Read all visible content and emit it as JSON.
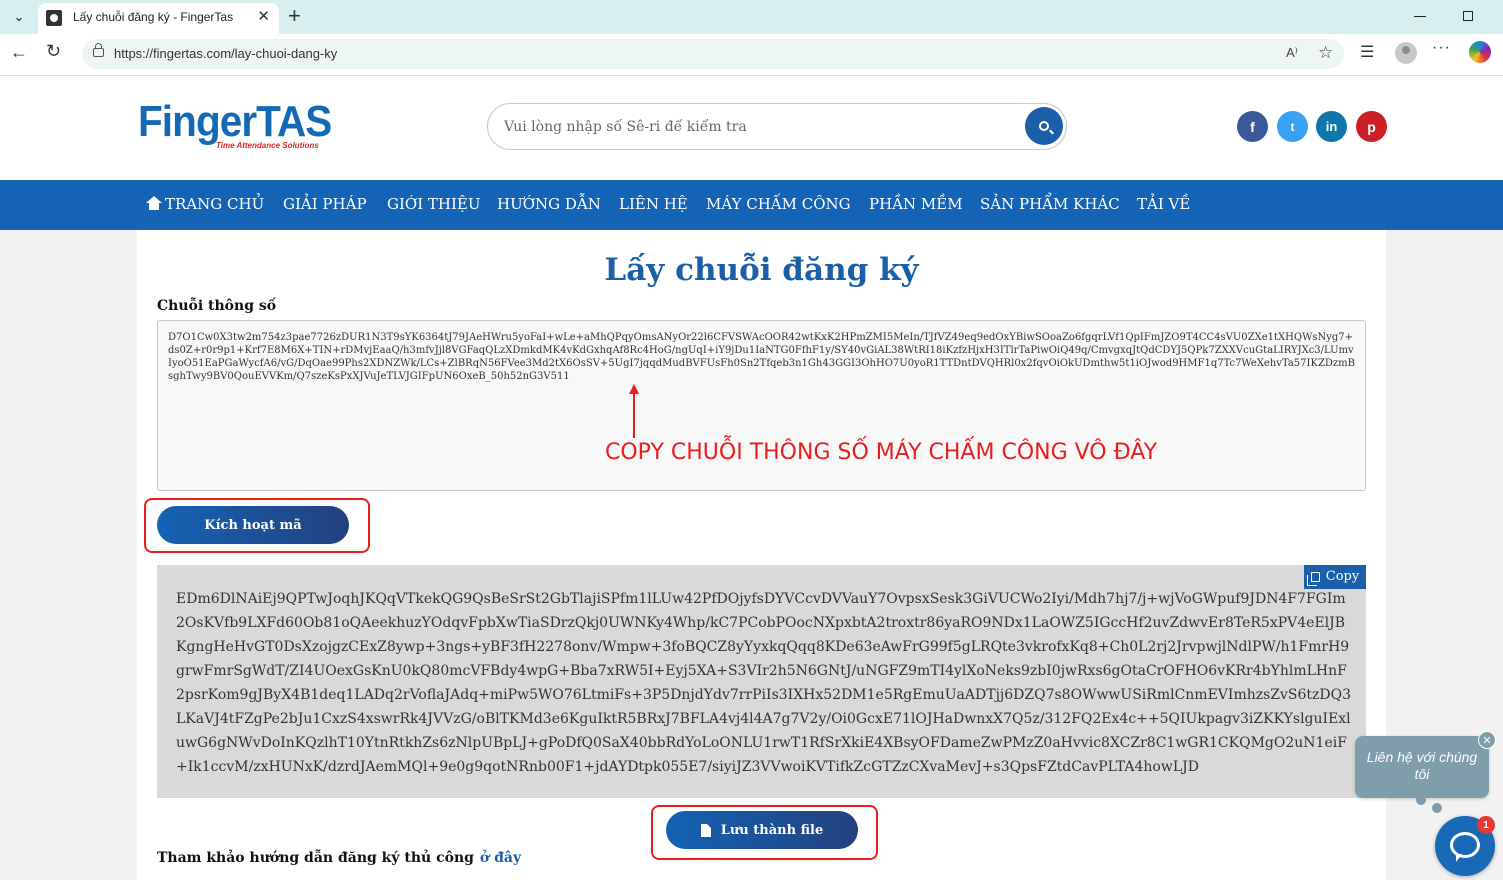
{
  "browser": {
    "tab_title": "Lấy chuỗi đăng ký - FingerTas",
    "url": "https://fingertas.com/lay-chuoi-dang-ky"
  },
  "header": {
    "logo_text": "FingerTAS",
    "logo_tagline": "Time Attendance Solutions",
    "search_placeholder": "Vui lòng nhập số Sê-ri để kiểm tra",
    "social": [
      "f",
      "t",
      "in",
      "p"
    ]
  },
  "nav": {
    "items": [
      "TRANG CHỦ",
      "GIẢI PHÁP",
      "GIỚI THIỆU",
      "HƯỚNG DẪN",
      "LIÊN HỆ",
      "MÁY CHẤM CÔNG",
      "PHẦN MỀM",
      "SẢN PHẨM KHÁC",
      "TẢI VỀ"
    ]
  },
  "main": {
    "title": "Lấy chuỗi đăng ký",
    "field_label": "Chuỗi thông số",
    "param_value": "D7O1Cw0X3tw2m754z3pae7726zDUR1N3T9sYK6364tJ79JAeHWru5yoFaI+wLe+aMhQPqyOmsANyOr22l6CFVSWAcOOR42wtKxK2HPmZMI5MeIn/TJfVZ49eq9edOxYBiwSOoaZo6fgqrLVf1QpIFmJZO9T4CC4sVU0ZXe1tXHQWsNyg7+ds0Z+r0r9p1+Krf7E8M6X+TIN+rDMvjEaaQ/h3mfvJjl8VGFaqQLzXDmkdMK4vKdGxhqAf8Rc4HoG/ngUqI+iY9jDu1IaNTG0FfhF1y/SY40vGiAL38WtRI18iKzfzHjxH3ITlrTaPiwOiQ49q/CmvgxqJtQdCDYJ5QPk7ZXXVcuGtaLIRYJXc3/LUmvIyoO51EaPGaWycfA6/vG/DqOae99Phs2XDNZWk/LCs+ZlBRqN56FVee3Md2tX6OsSV+5UgI7jqqdMudBVFUsFh0Sn2Tfqeb3n1Gh43GGI3OhHO7U0yoR1TTDntDVQHRl0x2fqvOiOkUDmthw5t1iOJwod9HMF1q7Tc7WeXehvTa57IKZDzmBsghTwy9BV0QouEVVKm/Q7szeKsPxXJVuJeTLVJGIFpUN6OxeB_50h52nG3V511",
    "annotation": "COPY CHUỖI THÔNG SỐ MÁY CHẤM CÔNG VÔ ĐÂY",
    "activate_label": "Kích hoạt mã",
    "copy_label": "Copy",
    "result_value": "EDm6DlNAiEj9QPTwJoqhJKQqVTkekQG9QsBeSrSt2GbTlajiSPfm1lLUw42PfDOjyfsDYVCcvDVVauY7OvpsxSesk3GiVUCWo2Iyi/Mdh7hj7/j+wjVoGWpuf9JDN4F7FGIm2OsKVfb9LXFd60Ob81oQAeekhuzYOdqvFpbXwTiaSDrzQkj0UWNKy4Whp/kC7PCobPOocNXpxbtA2troxtr86yaRO9NDx1LaOWZ5IGccHf2uvZdwvEr8TeR5xPV4eElJBKgngHeHvGT0DsXzojgzCExZ8ywp+3ngs+yBF3fH2278onv/Wmpw+3foBQCZ8yYyxkqQqq8KDe63eAwFrG99f5gLRQte3vkrofxKq8+Ch0L2rj2JrvpwjlNdlPW/h1FmrH9grwFmrSgWdT/ZI4UOexGsKnU0kQ80mcVFBdy4wpG+Bba7xRW5I+Eyj5XA+S3VIr2h5N6GNtJ/uNGFZ9mTI4ylXoNeks9zbI0jwRxs6gOtaCrOFHO6vKRr4bYhlmLHnF2psrKom9gJByX4B1deq1LADq2rVoflaJAdq+miPw5WO76LtmiFs+3P5DnjdYdv7rrPiIs3IXHx52DM1e5RgEmuUaADTjj6DZQ7s8OWwwUSiRmlCnmEVImhzsZvS6tzDQ3LKaVJ4tFZgPe2bJu1CxzS4xswrRk4JVVzG/oBlTKMd3e6KguIktR5BRxJ7BFLA4vj4l4A7g7V2y/Oi0GcxE71lOJHaDwnxX7Q5z/312FQ2Ex4c++5QIUkpagv3iZKKYslguIExluwG6gNWvDoInKQzlhT10YtnRtkhZs6zNlpUBpLJ+gPoDfQ0SaX40bbRdYoLoONLU1rwT1RfSrXkiE4XBsyOFDameZwPMzZ0aHvvic8XCZr8C1wGR1CKQMgO2uN1eiF+Ik1ccvM/zxHUNxK/dzrdJAemMQl+9e0g9qotNRnb00F1+jdAYDtpk055E7/siyiJZ3VVwoiKVTifkZcGTZzCXvaMevJ+s3QpsFZtdCavPLTA4howLJD",
    "save_label": "Lưu thành file",
    "ref_text": "Tham khảo hướng dẫn đăng ký thủ công",
    "ref_link": "ở đây"
  },
  "chat": {
    "bubble_text": "Liên hệ với chúng tôi",
    "close": "✕",
    "badge": "1"
  }
}
